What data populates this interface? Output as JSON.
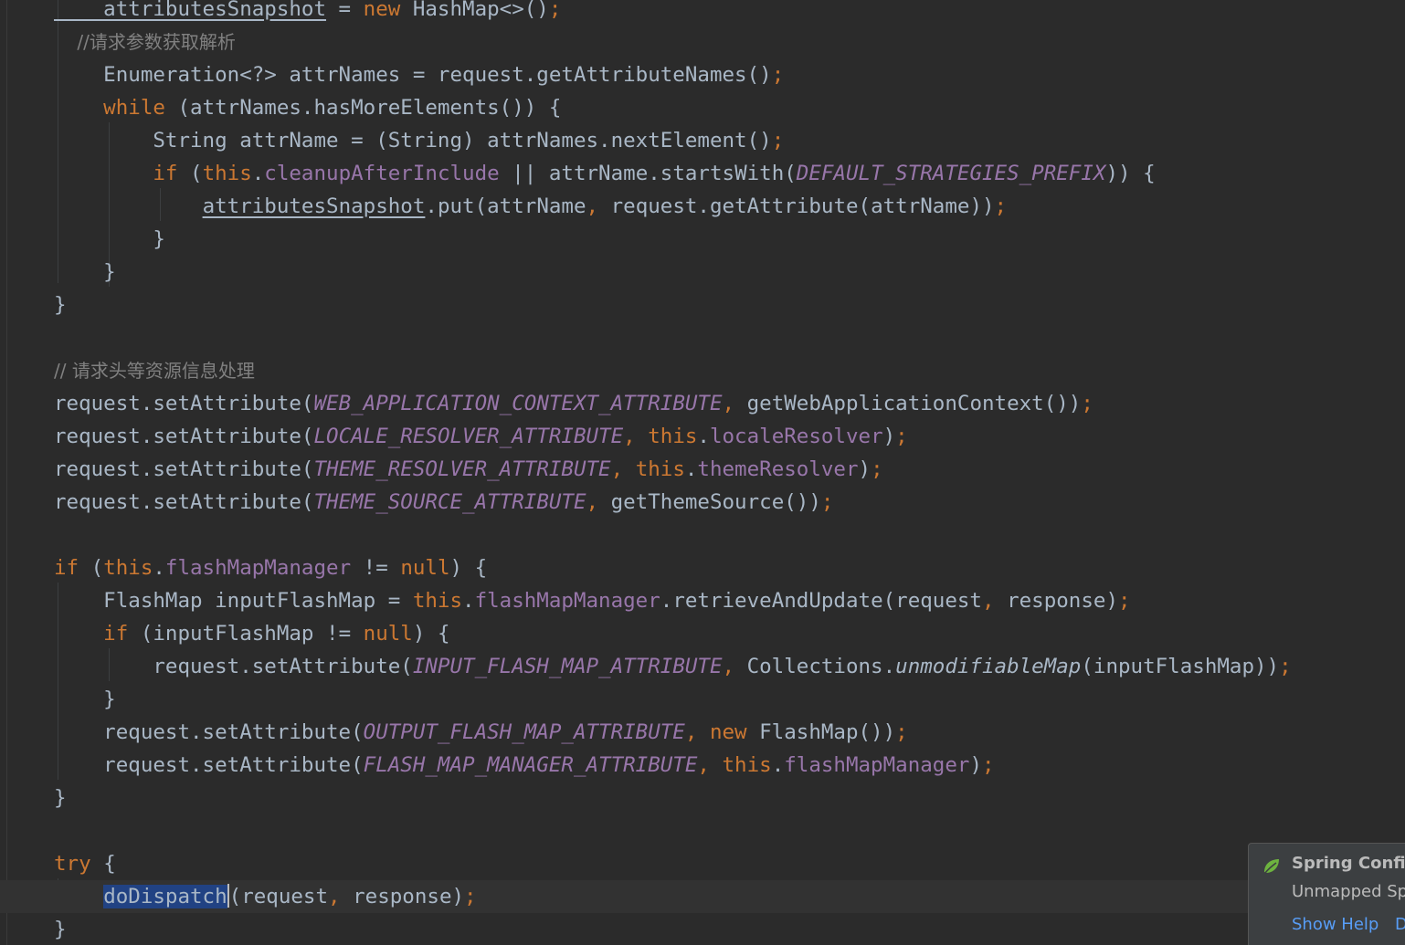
{
  "editor": {
    "lines": [
      [
        {
          "t": "    attributesSnapshot",
          "c": "plain ul"
        },
        {
          "t": " = ",
          "c": "plain"
        },
        {
          "t": "new ",
          "c": "kw"
        },
        {
          "t": "HashMap<>()",
          "c": "plain"
        },
        {
          "t": ";",
          "c": "kw"
        }
      ],
      [
        {
          "t": "    //请求参数获取解析",
          "c": "cmt"
        }
      ],
      [
        {
          "t": "    Enumeration<?> attrNames = request.getAttributeNames()",
          "c": "plain"
        },
        {
          "t": ";",
          "c": "kw"
        }
      ],
      [
        {
          "t": "    while ",
          "c": "kw"
        },
        {
          "t": "(attrNames.hasMoreElements()) {",
          "c": "plain"
        }
      ],
      [
        {
          "t": "        String attrName = (String) attrNames.nextElement()",
          "c": "plain"
        },
        {
          "t": ";",
          "c": "kw"
        }
      ],
      [
        {
          "t": "        if ",
          "c": "kw"
        },
        {
          "t": "(",
          "c": "plain"
        },
        {
          "t": "this",
          "c": "kw"
        },
        {
          "t": ".",
          "c": "plain"
        },
        {
          "t": "cleanupAfterInclude",
          "c": "field"
        },
        {
          "t": " || attrName.startsWith(",
          "c": "plain"
        },
        {
          "t": "DEFAULT_STRATEGIES_PREFIX",
          "c": "const"
        },
        {
          "t": ")) {",
          "c": "plain"
        }
      ],
      [
        {
          "t": "            ",
          "c": "plain"
        },
        {
          "t": "attributesSnapshot",
          "c": "plain ul"
        },
        {
          "t": ".put(attrName",
          "c": "plain"
        },
        {
          "t": ", ",
          "c": "kw"
        },
        {
          "t": "request.getAttribute(attrName))",
          "c": "plain"
        },
        {
          "t": ";",
          "c": "kw"
        }
      ],
      [
        {
          "t": "        }",
          "c": "plain"
        }
      ],
      [
        {
          "t": "    }",
          "c": "plain"
        }
      ],
      [
        {
          "t": "}",
          "c": "plain"
        }
      ],
      [],
      [
        {
          "t": "// 请求头等资源信息处理",
          "c": "cmt"
        }
      ],
      [
        {
          "t": "request.setAttribute(",
          "c": "plain"
        },
        {
          "t": "WEB_APPLICATION_CONTEXT_ATTRIBUTE",
          "c": "const"
        },
        {
          "t": ", ",
          "c": "kw"
        },
        {
          "t": "getWebApplicationContext())",
          "c": "plain"
        },
        {
          "t": ";",
          "c": "kw"
        }
      ],
      [
        {
          "t": "request.setAttribute(",
          "c": "plain"
        },
        {
          "t": "LOCALE_RESOLVER_ATTRIBUTE",
          "c": "const"
        },
        {
          "t": ", ",
          "c": "kw"
        },
        {
          "t": "this",
          "c": "kw"
        },
        {
          "t": ".",
          "c": "plain"
        },
        {
          "t": "localeResolver",
          "c": "field"
        },
        {
          "t": ")",
          "c": "plain"
        },
        {
          "t": ";",
          "c": "kw"
        }
      ],
      [
        {
          "t": "request.setAttribute(",
          "c": "plain"
        },
        {
          "t": "THEME_RESOLVER_ATTRIBUTE",
          "c": "const"
        },
        {
          "t": ", ",
          "c": "kw"
        },
        {
          "t": "this",
          "c": "kw"
        },
        {
          "t": ".",
          "c": "plain"
        },
        {
          "t": "themeResolver",
          "c": "field"
        },
        {
          "t": ")",
          "c": "plain"
        },
        {
          "t": ";",
          "c": "kw"
        }
      ],
      [
        {
          "t": "request.setAttribute(",
          "c": "plain"
        },
        {
          "t": "THEME_SOURCE_ATTRIBUTE",
          "c": "const"
        },
        {
          "t": ", ",
          "c": "kw"
        },
        {
          "t": "getThemeSource())",
          "c": "plain"
        },
        {
          "t": ";",
          "c": "kw"
        }
      ],
      [],
      [
        {
          "t": "if ",
          "c": "kw"
        },
        {
          "t": "(",
          "c": "plain"
        },
        {
          "t": "this",
          "c": "kw"
        },
        {
          "t": ".",
          "c": "plain"
        },
        {
          "t": "flashMapManager",
          "c": "field"
        },
        {
          "t": " != ",
          "c": "plain"
        },
        {
          "t": "null",
          "c": "kw"
        },
        {
          "t": ") {",
          "c": "plain"
        }
      ],
      [
        {
          "t": "    FlashMap inputFlashMap = ",
          "c": "plain"
        },
        {
          "t": "this",
          "c": "kw"
        },
        {
          "t": ".",
          "c": "plain"
        },
        {
          "t": "flashMapManager",
          "c": "field"
        },
        {
          "t": ".retrieveAndUpdate(request",
          "c": "plain"
        },
        {
          "t": ", ",
          "c": "kw"
        },
        {
          "t": "response)",
          "c": "plain"
        },
        {
          "t": ";",
          "c": "kw"
        }
      ],
      [
        {
          "t": "    if ",
          "c": "kw"
        },
        {
          "t": "(inputFlashMap != ",
          "c": "plain"
        },
        {
          "t": "null",
          "c": "kw"
        },
        {
          "t": ") {",
          "c": "plain"
        }
      ],
      [
        {
          "t": "        request.setAttribute(",
          "c": "plain"
        },
        {
          "t": "INPUT_FLASH_MAP_ATTRIBUTE",
          "c": "const"
        },
        {
          "t": ", ",
          "c": "kw"
        },
        {
          "t": "Collections.",
          "c": "plain"
        },
        {
          "t": "unmodifiableMap",
          "c": "plain italic"
        },
        {
          "t": "(inputFlashMap))",
          "c": "plain"
        },
        {
          "t": ";",
          "c": "kw"
        }
      ],
      [
        {
          "t": "    }",
          "c": "plain"
        }
      ],
      [
        {
          "t": "    request.setAttribute(",
          "c": "plain"
        },
        {
          "t": "OUTPUT_FLASH_MAP_ATTRIBUTE",
          "c": "const"
        },
        {
          "t": ", ",
          "c": "kw"
        },
        {
          "t": "new ",
          "c": "kw"
        },
        {
          "t": "FlashMap())",
          "c": "plain"
        },
        {
          "t": ";",
          "c": "kw"
        }
      ],
      [
        {
          "t": "    request.setAttribute(",
          "c": "plain"
        },
        {
          "t": "FLASH_MAP_MANAGER_ATTRIBUTE",
          "c": "const"
        },
        {
          "t": ", ",
          "c": "kw"
        },
        {
          "t": "this",
          "c": "kw"
        },
        {
          "t": ".",
          "c": "plain"
        },
        {
          "t": "flashMapManager",
          "c": "field"
        },
        {
          "t": ")",
          "c": "plain"
        },
        {
          "t": ";",
          "c": "kw"
        }
      ],
      [
        {
          "t": "}",
          "c": "plain"
        }
      ],
      [],
      [
        {
          "t": "try ",
          "c": "kw"
        },
        {
          "t": "{",
          "c": "plain"
        }
      ],
      [
        {
          "t": "    ",
          "c": "plain"
        },
        {
          "t": "doDispatch",
          "c": "plain sel"
        },
        {
          "t": "CARET",
          "c": "caret"
        },
        {
          "t": "(request",
          "c": "plain"
        },
        {
          "t": ", ",
          "c": "kw"
        },
        {
          "t": "response)",
          "c": "plain"
        },
        {
          "t": ";",
          "c": "kw"
        }
      ],
      [
        {
          "t": "}",
          "c": "plain"
        }
      ]
    ],
    "caret_line": 27
  },
  "notification": {
    "title": "Spring Config",
    "body": "Unmapped Sp",
    "link_primary": "Show Help",
    "link_secondary": "D",
    "icon": "spring-leaf-icon"
  }
}
